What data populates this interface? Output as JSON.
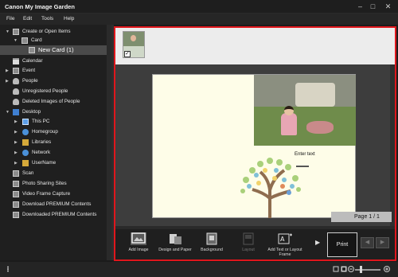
{
  "window": {
    "title": "Canon My Image Garden",
    "minimize_glyph": "–",
    "maximize_glyph": "□",
    "close_glyph": "✕"
  },
  "menu": [
    "File",
    "Edit",
    "Tools",
    "Help"
  ],
  "sidebar": {
    "items": [
      {
        "label": "Create or Open Items",
        "icon": "create-items-icon",
        "arrow": "▼"
      },
      {
        "label": "Card",
        "icon": "card-folder-icon",
        "arrow": "▼"
      },
      {
        "label": "New Card (1)",
        "icon": "card-item-icon",
        "arrow": ""
      },
      {
        "label": "Calendar",
        "icon": "calendar-icon",
        "arrow": ""
      },
      {
        "label": "Event",
        "icon": "event-icon",
        "arrow": "▶"
      },
      {
        "label": "People",
        "icon": "people-icon",
        "arrow": "▶"
      },
      {
        "label": "Unregistered People",
        "icon": "unregistered-people-icon",
        "arrow": ""
      },
      {
        "label": "Deleted Images of People",
        "icon": "deleted-people-icon",
        "arrow": ""
      },
      {
        "label": "Desktop",
        "icon": "desktop-icon",
        "arrow": "▼"
      },
      {
        "label": "This PC",
        "icon": "this-pc-icon",
        "arrow": "▶"
      },
      {
        "label": "Homegroup",
        "icon": "homegroup-icon",
        "arrow": "▶"
      },
      {
        "label": "Libraries",
        "icon": "libraries-icon",
        "arrow": "▶"
      },
      {
        "label": "Network",
        "icon": "network-icon",
        "arrow": "▶"
      },
      {
        "label": "UserName",
        "icon": "user-folder-icon",
        "arrow": "▶"
      },
      {
        "label": "Scan",
        "icon": "scan-icon",
        "arrow": ""
      },
      {
        "label": "Photo Sharing Sites",
        "icon": "photo-sharing-icon",
        "arrow": ""
      },
      {
        "label": "Video Frame Capture",
        "icon": "video-capture-icon",
        "arrow": ""
      },
      {
        "label": "Download PREMIUM Contents",
        "icon": "download-premium-icon",
        "arrow": ""
      },
      {
        "label": "Downloaded PREMIUM Contents",
        "icon": "downloaded-premium-icon",
        "arrow": ""
      }
    ]
  },
  "editor": {
    "enter_text": "Enter text",
    "page_indicator": "Page 1 / 1",
    "thumbnail_checked": "✓"
  },
  "toolbar": {
    "add_image": "Add Image",
    "design_and_paper": "Design and Paper",
    "background": "Background",
    "layout": "Layout",
    "add_text_or_layout_frame": "Add Text or Layout Frame",
    "next_glyph": "▶",
    "print": "Print",
    "prev_page_glyph": "◀",
    "next_page_glyph": "▶"
  },
  "colors": {
    "accent_frame": "#e0161c",
    "background": "#1b1b1b",
    "canvas_page": "#fefde8"
  }
}
